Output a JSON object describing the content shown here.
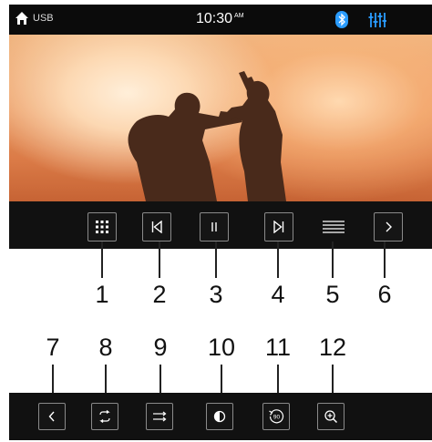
{
  "status_bar": {
    "source": "USB",
    "time": "10:30",
    "ampm": "AM",
    "home_icon": "home-icon",
    "bluetooth_icon": "bluetooth-icon",
    "equalizer_icon": "equalizer-icon",
    "accent_color": "#2a9cff"
  },
  "video": {
    "description_icon": "video-frame"
  },
  "control_bar": {
    "buttons": [
      {
        "icon": "menu-grid-icon"
      },
      {
        "icon": "previous-track-icon"
      },
      {
        "icon": "pause-icon"
      },
      {
        "icon": "next-track-icon"
      },
      {
        "icon": "list-icon"
      },
      {
        "icon": "chevron-right-icon"
      }
    ]
  },
  "bottom_bar": {
    "buttons": [
      {
        "icon": "chevron-left-icon"
      },
      {
        "icon": "repeat-icon"
      },
      {
        "icon": "shuffle-icon"
      },
      {
        "icon": "brightness-icon"
      },
      {
        "icon": "rotate-90-icon",
        "label": "90"
      },
      {
        "icon": "zoom-in-icon"
      }
    ]
  },
  "callouts": [
    "1",
    "2",
    "3",
    "4",
    "5",
    "6",
    "7",
    "8",
    "9",
    "10",
    "11",
    "12"
  ]
}
